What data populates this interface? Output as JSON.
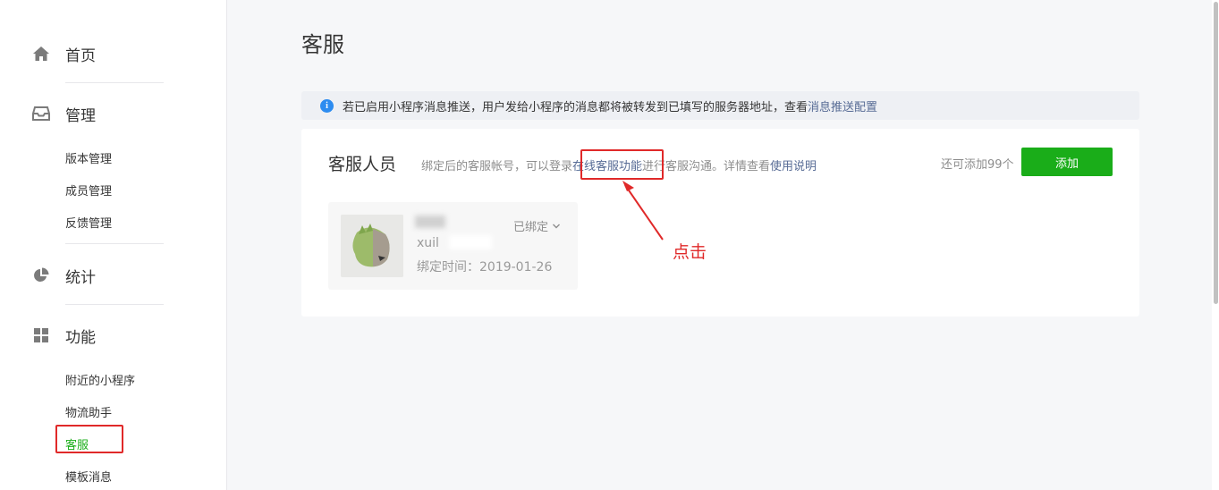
{
  "sidebar": {
    "home": {
      "label": "首页",
      "icon": "home-icon"
    },
    "manage": {
      "label": "管理",
      "icon": "inbox-icon",
      "items": [
        "版本管理",
        "成员管理",
        "反馈管理"
      ]
    },
    "stats": {
      "label": "统计",
      "icon": "pie-chart-icon"
    },
    "features": {
      "label": "功能",
      "icon": "grid-icon",
      "items": [
        "附近的小程序",
        "物流助手",
        "客服",
        "模板消息"
      ],
      "active_index": 2
    }
  },
  "main": {
    "title": "客服",
    "notice": {
      "text": "若已启用小程序消息推送，用户发给小程序的消息都将被转发到已填写的服务器地址，查看",
      "link": "消息推送配置"
    },
    "card": {
      "title": "客服人员",
      "desc_before": "绑定后的客服帐号，可以登录",
      "desc_link1": "在线客服功能",
      "desc_middle": "进行客服沟通。详情查看",
      "desc_link2": "使用说明",
      "quota": "还可添加99个",
      "add_button": "添加",
      "agent": {
        "account_prefix": "xuil",
        "bind_time": "绑定时间：2019-01-26",
        "status": "已绑定"
      }
    },
    "annotation": "点击"
  },
  "colors": {
    "accent": "#1aad19",
    "link": "#576b95",
    "annotation": "#e02929"
  }
}
